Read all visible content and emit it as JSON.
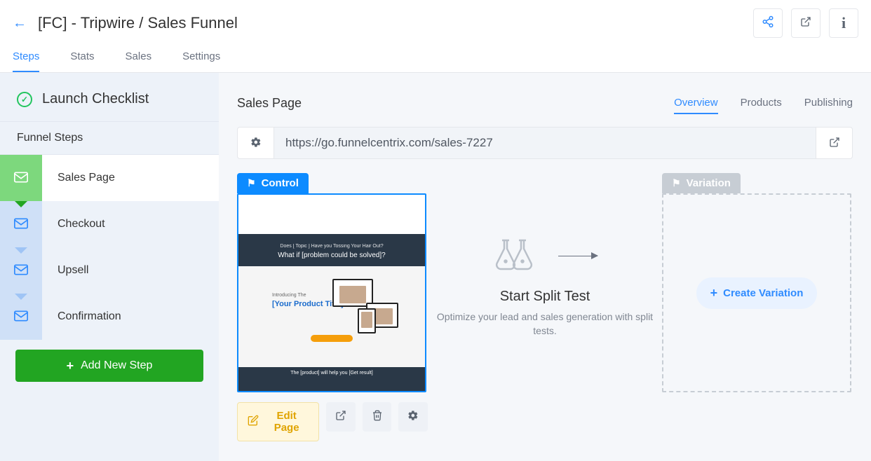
{
  "header": {
    "title": "[FC] - Tripwire / Sales Funnel"
  },
  "nav": {
    "tabs": [
      "Steps",
      "Stats",
      "Sales",
      "Settings"
    ],
    "active": 0
  },
  "sidebar": {
    "launch_checklist": "Launch Checklist",
    "funnel_steps_label": "Funnel Steps",
    "steps": [
      {
        "label": "Sales Page"
      },
      {
        "label": "Checkout"
      },
      {
        "label": "Upsell"
      },
      {
        "label": "Confirmation"
      }
    ],
    "add_step": "Add New Step"
  },
  "main": {
    "title": "Sales Page",
    "sub_tabs": [
      "Overview",
      "Products",
      "Publishing"
    ],
    "url": "https://go.funnelcentrix.com/sales-7227",
    "control_label": "Control",
    "variation_label": "Variation",
    "thumb": {
      "eyebrow": "Does [ Topic ] Have you Tossing Your Hair Out?",
      "headline": "What if [problem could be solved]?",
      "intro": "Introducing The",
      "product_title": "[Your Product Title]",
      "footer": "The [product] will help you [Get result]"
    },
    "edit_page": "Edit Page",
    "split": {
      "title": "Start Split Test",
      "subtitle": "Optimize your lead and sales generation with split tests."
    },
    "create_variation": "Create Variation"
  }
}
